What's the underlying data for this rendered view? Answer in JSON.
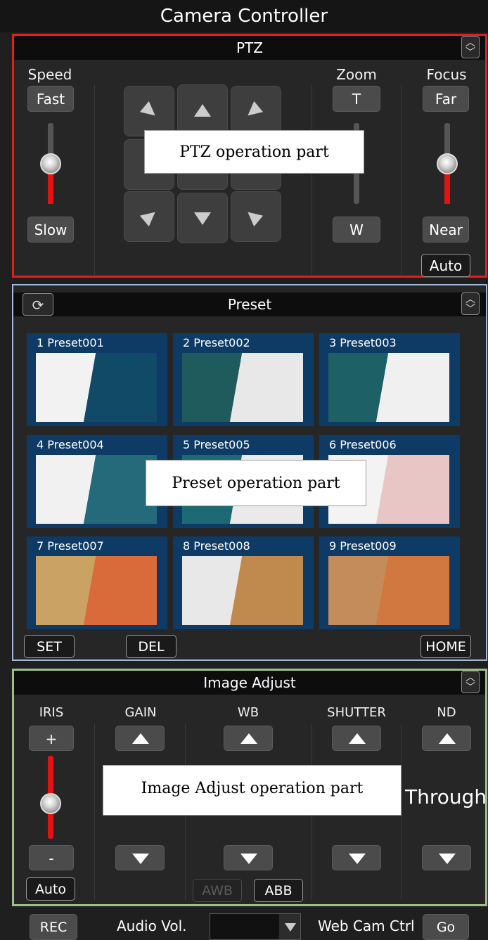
{
  "window": {
    "title": "Camera Controller"
  },
  "ptz": {
    "title": "PTZ",
    "speed": {
      "label": "Speed",
      "fast": "Fast",
      "slow": "Slow",
      "level": 0.45
    },
    "zoom": {
      "label": "Zoom",
      "tele": "T",
      "wide": "W"
    },
    "focus": {
      "label": "Focus",
      "far": "Far",
      "near": "Near",
      "auto": "Auto",
      "level": 0.45
    },
    "callout": "PTZ operation part"
  },
  "preset": {
    "title": "Preset",
    "items": [
      {
        "num": "1",
        "name": "Preset001"
      },
      {
        "num": "2",
        "name": "Preset002"
      },
      {
        "num": "3",
        "name": "Preset003"
      },
      {
        "num": "4",
        "name": "Preset004"
      },
      {
        "num": "5",
        "name": "Preset005"
      },
      {
        "num": "6",
        "name": "Preset006"
      },
      {
        "num": "7",
        "name": "Preset007"
      },
      {
        "num": "8",
        "name": "Preset008"
      },
      {
        "num": "9",
        "name": "Preset009"
      }
    ],
    "set": "SET",
    "del": "DEL",
    "home": "HOME",
    "callout": "Preset operation part"
  },
  "image_adjust": {
    "title": "Image Adjust",
    "iris": {
      "label": "IRIS",
      "plus": "+",
      "minus": "-",
      "auto": "Auto",
      "level": 0.5
    },
    "gain": {
      "label": "GAIN"
    },
    "wb": {
      "label": "WB",
      "awb": "AWB",
      "abb": "ABB"
    },
    "shutter": {
      "label": "SHUTTER"
    },
    "nd": {
      "label": "ND",
      "value": "Through"
    },
    "callout": "Image Adjust operation part"
  },
  "footer": {
    "rec": "REC",
    "audio_label": "Audio Vol.",
    "webcam_label": "Web Cam Ctrl",
    "go": "Go"
  },
  "colors": {
    "ptz_border": "#e31e1e",
    "preset_border": "#9fb9d6",
    "image_border": "#9bc18a",
    "slider_fill": "#e01414",
    "preset_bg": "#0e3b66"
  }
}
